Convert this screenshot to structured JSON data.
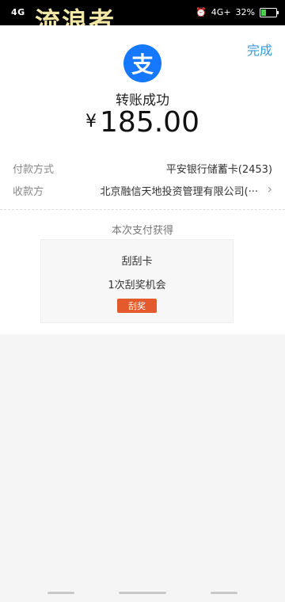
{
  "status_bar": {
    "network_left": "4G",
    "alarm_icon": "alarm-icon",
    "network_right": "4G+",
    "battery_percent": "32%",
    "battery_level": 0.32,
    "watermark": "流浪者"
  },
  "header": {
    "done_label": "完成",
    "logo_char": "支",
    "logo_color": "#1677ff"
  },
  "result": {
    "title": "转账成功",
    "currency": "¥",
    "amount": "185.00"
  },
  "details": {
    "payment_method_label": "付款方式",
    "payment_method_value": "平安银行储蓄卡(2453)",
    "payee_label": "收款方",
    "payee_value": "北京融信天地投资管理有限公司(···"
  },
  "reward": {
    "caption": "本次支付获得",
    "name": "刮刮卡",
    "desc": "1次刮奖机会",
    "button_label": "刮奖",
    "button_color": "#e45a2d"
  },
  "colors": {
    "accent": "#3b9ad9"
  }
}
